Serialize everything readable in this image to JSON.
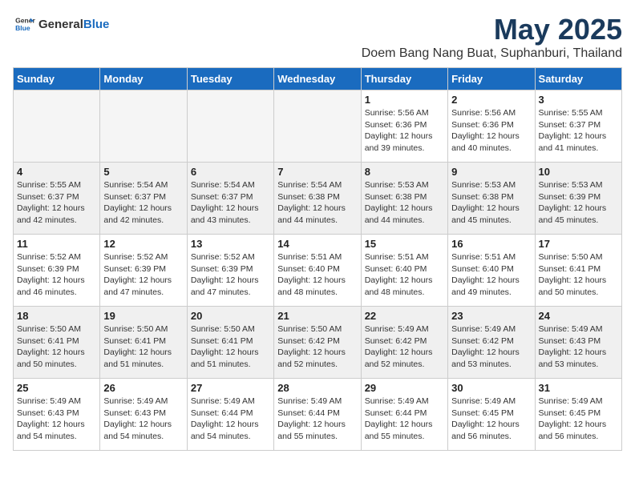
{
  "header": {
    "logo_general": "General",
    "logo_blue": "Blue",
    "month_title": "May 2025",
    "location": "Doem Bang Nang Buat, Suphanburi, Thailand"
  },
  "weekdays": [
    "Sunday",
    "Monday",
    "Tuesday",
    "Wednesday",
    "Thursday",
    "Friday",
    "Saturday"
  ],
  "weeks": [
    [
      {
        "day": "",
        "info": ""
      },
      {
        "day": "",
        "info": ""
      },
      {
        "day": "",
        "info": ""
      },
      {
        "day": "",
        "info": ""
      },
      {
        "day": "1",
        "info": "Sunrise: 5:56 AM\nSunset: 6:36 PM\nDaylight: 12 hours\nand 39 minutes."
      },
      {
        "day": "2",
        "info": "Sunrise: 5:56 AM\nSunset: 6:36 PM\nDaylight: 12 hours\nand 40 minutes."
      },
      {
        "day": "3",
        "info": "Sunrise: 5:55 AM\nSunset: 6:37 PM\nDaylight: 12 hours\nand 41 minutes."
      }
    ],
    [
      {
        "day": "4",
        "info": "Sunrise: 5:55 AM\nSunset: 6:37 PM\nDaylight: 12 hours\nand 42 minutes."
      },
      {
        "day": "5",
        "info": "Sunrise: 5:54 AM\nSunset: 6:37 PM\nDaylight: 12 hours\nand 42 minutes."
      },
      {
        "day": "6",
        "info": "Sunrise: 5:54 AM\nSunset: 6:37 PM\nDaylight: 12 hours\nand 43 minutes."
      },
      {
        "day": "7",
        "info": "Sunrise: 5:54 AM\nSunset: 6:38 PM\nDaylight: 12 hours\nand 44 minutes."
      },
      {
        "day": "8",
        "info": "Sunrise: 5:53 AM\nSunset: 6:38 PM\nDaylight: 12 hours\nand 44 minutes."
      },
      {
        "day": "9",
        "info": "Sunrise: 5:53 AM\nSunset: 6:38 PM\nDaylight: 12 hours\nand 45 minutes."
      },
      {
        "day": "10",
        "info": "Sunrise: 5:53 AM\nSunset: 6:39 PM\nDaylight: 12 hours\nand 45 minutes."
      }
    ],
    [
      {
        "day": "11",
        "info": "Sunrise: 5:52 AM\nSunset: 6:39 PM\nDaylight: 12 hours\nand 46 minutes."
      },
      {
        "day": "12",
        "info": "Sunrise: 5:52 AM\nSunset: 6:39 PM\nDaylight: 12 hours\nand 47 minutes."
      },
      {
        "day": "13",
        "info": "Sunrise: 5:52 AM\nSunset: 6:39 PM\nDaylight: 12 hours\nand 47 minutes."
      },
      {
        "day": "14",
        "info": "Sunrise: 5:51 AM\nSunset: 6:40 PM\nDaylight: 12 hours\nand 48 minutes."
      },
      {
        "day": "15",
        "info": "Sunrise: 5:51 AM\nSunset: 6:40 PM\nDaylight: 12 hours\nand 48 minutes."
      },
      {
        "day": "16",
        "info": "Sunrise: 5:51 AM\nSunset: 6:40 PM\nDaylight: 12 hours\nand 49 minutes."
      },
      {
        "day": "17",
        "info": "Sunrise: 5:50 AM\nSunset: 6:41 PM\nDaylight: 12 hours\nand 50 minutes."
      }
    ],
    [
      {
        "day": "18",
        "info": "Sunrise: 5:50 AM\nSunset: 6:41 PM\nDaylight: 12 hours\nand 50 minutes."
      },
      {
        "day": "19",
        "info": "Sunrise: 5:50 AM\nSunset: 6:41 PM\nDaylight: 12 hours\nand 51 minutes."
      },
      {
        "day": "20",
        "info": "Sunrise: 5:50 AM\nSunset: 6:41 PM\nDaylight: 12 hours\nand 51 minutes."
      },
      {
        "day": "21",
        "info": "Sunrise: 5:50 AM\nSunset: 6:42 PM\nDaylight: 12 hours\nand 52 minutes."
      },
      {
        "day": "22",
        "info": "Sunrise: 5:49 AM\nSunset: 6:42 PM\nDaylight: 12 hours\nand 52 minutes."
      },
      {
        "day": "23",
        "info": "Sunrise: 5:49 AM\nSunset: 6:42 PM\nDaylight: 12 hours\nand 53 minutes."
      },
      {
        "day": "24",
        "info": "Sunrise: 5:49 AM\nSunset: 6:43 PM\nDaylight: 12 hours\nand 53 minutes."
      }
    ],
    [
      {
        "day": "25",
        "info": "Sunrise: 5:49 AM\nSunset: 6:43 PM\nDaylight: 12 hours\nand 54 minutes."
      },
      {
        "day": "26",
        "info": "Sunrise: 5:49 AM\nSunset: 6:43 PM\nDaylight: 12 hours\nand 54 minutes."
      },
      {
        "day": "27",
        "info": "Sunrise: 5:49 AM\nSunset: 6:44 PM\nDaylight: 12 hours\nand 54 minutes."
      },
      {
        "day": "28",
        "info": "Sunrise: 5:49 AM\nSunset: 6:44 PM\nDaylight: 12 hours\nand 55 minutes."
      },
      {
        "day": "29",
        "info": "Sunrise: 5:49 AM\nSunset: 6:44 PM\nDaylight: 12 hours\nand 55 minutes."
      },
      {
        "day": "30",
        "info": "Sunrise: 5:49 AM\nSunset: 6:45 PM\nDaylight: 12 hours\nand 56 minutes."
      },
      {
        "day": "31",
        "info": "Sunrise: 5:49 AM\nSunset: 6:45 PM\nDaylight: 12 hours\nand 56 minutes."
      }
    ]
  ]
}
